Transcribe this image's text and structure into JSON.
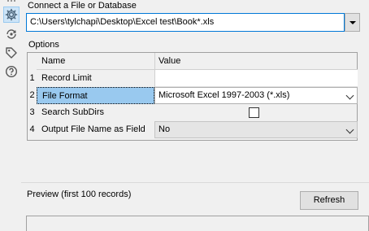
{
  "rail": {
    "icons": [
      "settings-gear-icon",
      "connection-icon",
      "tag-icon",
      "help-icon"
    ]
  },
  "connection": {
    "label": "Connect a File or Database",
    "value": "C:\\Users\\tylchapi\\Desktop\\Excel test\\Book*.xls"
  },
  "options": {
    "label": "Options",
    "header": {
      "name": "Name",
      "value": "Value"
    },
    "rows": [
      {
        "index": "1",
        "name": "Record Limit",
        "value": ""
      },
      {
        "index": "2",
        "name": "File Format",
        "value": "Microsoft Excel 1997-2003 (*.xls)"
      },
      {
        "index": "3",
        "name": "Search SubDirs",
        "value": "",
        "checked": false
      },
      {
        "index": "4",
        "name": "Output File Name as Field",
        "value": "No"
      }
    ]
  },
  "preview": {
    "label": "Preview (first 100 records)",
    "refresh_label": "Refresh"
  },
  "colors": {
    "selection": "#99c9ef",
    "focus_border": "#0078d7",
    "active_icon_bg": "#cde4f7"
  }
}
